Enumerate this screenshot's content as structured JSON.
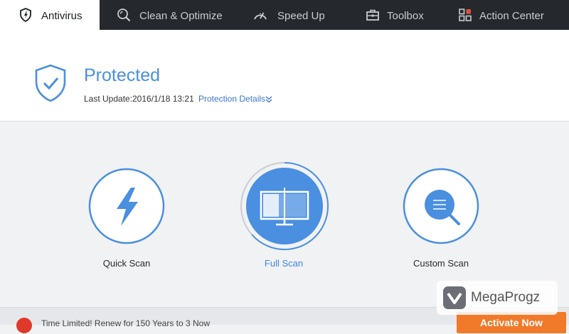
{
  "tabs": [
    {
      "label": "Antivirus",
      "icon": "shield-icon",
      "active": true
    },
    {
      "label": "Clean & Optimize",
      "icon": "clean-magnifier-icon",
      "active": false
    },
    {
      "label": "Speed Up",
      "icon": "speedometer-icon",
      "active": false
    },
    {
      "label": "Toolbox",
      "icon": "toolbox-icon",
      "active": false
    },
    {
      "label": "Action Center",
      "icon": "grid-icon",
      "active": false
    }
  ],
  "status": {
    "title": "Protected",
    "update_label": "Last Update:",
    "update_value": "2016/1/18 13:21",
    "details_link": "Protection Details"
  },
  "scans": [
    {
      "label": "Quick Scan",
      "icon": "lightning-icon",
      "selected": false
    },
    {
      "label": "Full Scan",
      "icon": "monitor-icon",
      "selected": true
    },
    {
      "label": "Custom Scan",
      "icon": "search-list-icon",
      "selected": false
    }
  ],
  "footer": {
    "promo_text": "Time Limited! Renew for 150 Years to 3 Now",
    "activate_label": "Activate Now"
  },
  "watermark": {
    "text": "MegaProgz"
  },
  "colors": {
    "accent": "#4a8fe0",
    "tabbar": "#25282d",
    "activate": "#f07a2a"
  }
}
